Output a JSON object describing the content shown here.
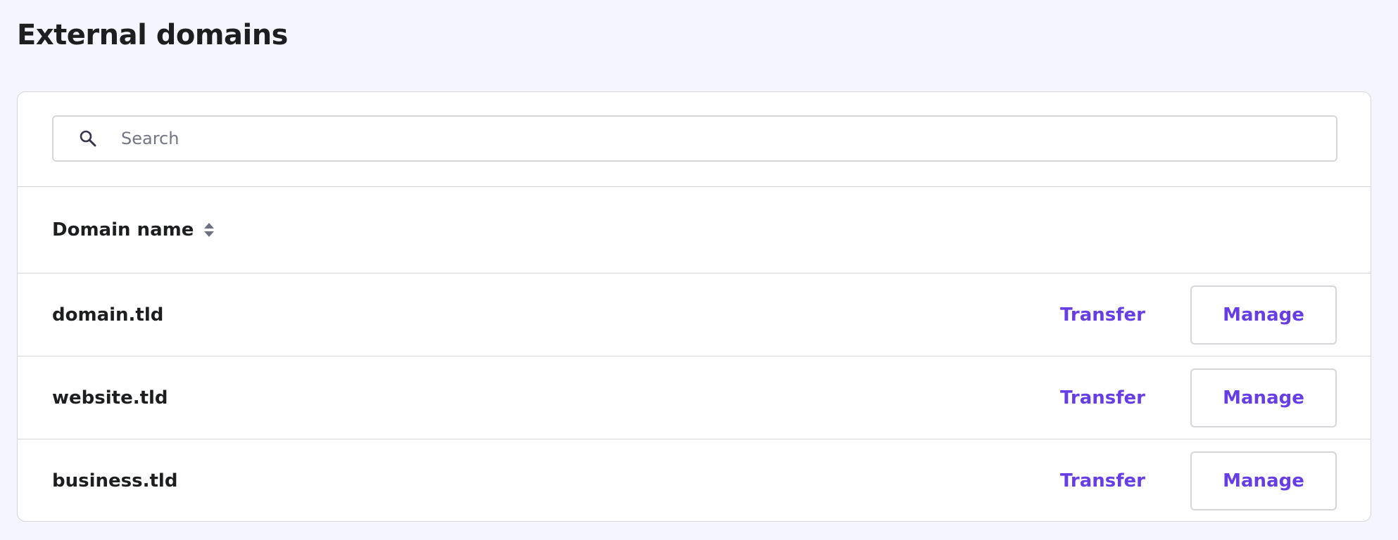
{
  "page": {
    "title": "External domains"
  },
  "search": {
    "placeholder": "Search",
    "value": ""
  },
  "table": {
    "columns": [
      {
        "label": "Domain name",
        "sortable": true
      }
    ],
    "rows": [
      {
        "domain": "domain.tld",
        "transfer_label": "Transfer",
        "manage_label": "Manage"
      },
      {
        "domain": "website.tld",
        "transfer_label": "Transfer",
        "manage_label": "Manage"
      },
      {
        "domain": "business.tld",
        "transfer_label": "Transfer",
        "manage_label": "Manage"
      }
    ]
  },
  "icons": {
    "search": "search-icon",
    "sort": "sort-icon"
  },
  "colors": {
    "background": "#f4f5ff",
    "card": "#ffffff",
    "border": "#d5d6da",
    "text": "#1d1e20",
    "accent": "#673de6",
    "placeholder": "#727586"
  }
}
